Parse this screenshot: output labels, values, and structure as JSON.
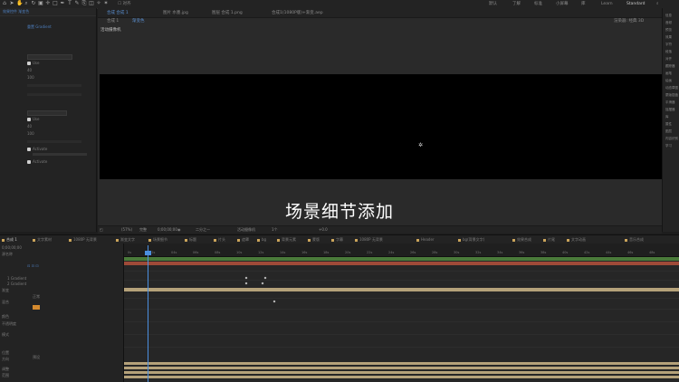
{
  "toolbar": {
    "tools": [
      "home-icon",
      "select-icon",
      "hand-icon",
      "zoom-icon",
      "rotate-icon",
      "camera-icon",
      "pan-behind-icon",
      "rect-mask-icon",
      "pen-icon",
      "type-icon",
      "brush-icon",
      "clone-icon",
      "eraser-icon",
      "roto-icon",
      "puppet-icon"
    ],
    "workspaces": [
      "默认",
      "了解",
      "标准",
      "小屏幕",
      "库",
      "Learn",
      "Standard"
    ],
    "search_label": "搜索帮助"
  },
  "left_panel": {
    "tab_label": "效果控件 渐变色",
    "blue_label": "重置  Gradient",
    "rows": [
      "Normal",
      "Use",
      "40",
      "100",
      "Normal",
      "Use",
      "40",
      "100",
      "Activate",
      "Activate"
    ],
    "effect_labels": [
      "混合模式",
      "",
      "透明度",
      "位置",
      "",
      "颜色",
      "",
      "",
      "",
      "",
      ""
    ]
  },
  "viewer": {
    "tabs": [
      "合成 合成 1",
      "图片 水墨.jpg",
      "图层 合成 1.png",
      "合成1(1080P版)+渐变.aep"
    ],
    "sub_tabs": [
      "合成 1",
      "渐变色"
    ],
    "comp_label": "活动摄像机",
    "subtitle": "场景细节添加",
    "bottom_items": [
      "(57%)",
      "完整",
      "0;00;00;00",
      "二分之一",
      "活动摄像机",
      "1个",
      "+0.0"
    ],
    "right_label": "渲染器: 经典 3D"
  },
  "right_panel": {
    "items": [
      "信息",
      "音频",
      "预览",
      "效果",
      "字符",
      "段落",
      "对齐",
      "跟踪器",
      "画笔",
      "绘画",
      "动态草图",
      "蒙版插值",
      "平滑器",
      "摇摆器",
      "库",
      "属性",
      "图层",
      "内容识别",
      "学习"
    ]
  },
  "timeline": {
    "tabs": [
      "合成 1",
      "文字素材",
      "1080P 无背景",
      "渐变文字",
      "场景细节",
      "标题",
      "片头",
      "遮罩",
      "bg",
      "背景元素",
      "蒙版",
      "字幕",
      "1080P 无背景",
      "Header",
      "bg(背景文字)",
      "效果合成",
      "片尾",
      "文字动画",
      "音乐合成"
    ],
    "timecode": "0;00;00;00",
    "ruler_ticks": [
      "0s",
      "02s",
      "04s",
      "06s",
      "08s",
      "10s",
      "12s",
      "14s",
      "16s",
      "18s",
      "20s",
      "22s",
      "24s",
      "26s",
      "28s",
      "30s",
      "32s",
      "34s",
      "36s",
      "38s",
      "40s",
      "42s",
      "44s",
      "46s",
      "48s"
    ],
    "layer_labels": [
      "源名称",
      "1 Gradient",
      "2 Gradient",
      "渐变",
      "混合",
      "颜色",
      "不透明度",
      "模式",
      "位置",
      "方向",
      "调整",
      "范围",
      "预设"
    ],
    "mode_value": "正常",
    "ruler_value": "无"
  }
}
